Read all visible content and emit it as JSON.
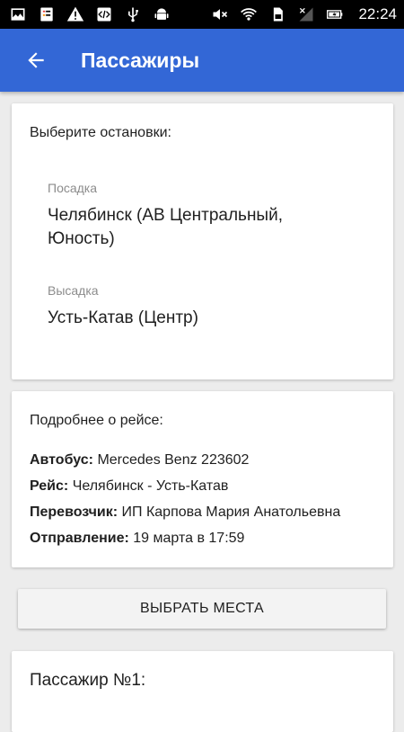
{
  "status_bar": {
    "time": "22:24",
    "left_icons": [
      "gallery-icon",
      "task-icon",
      "warning-icon",
      "code-icon",
      "usb-icon",
      "android-icon"
    ],
    "right_icons": [
      "mute-icon",
      "wifi-icon",
      "sim-icon",
      "signal-icon",
      "battery-icon"
    ]
  },
  "app_bar": {
    "title": "Пассажиры",
    "color": "#3367d6"
  },
  "stops": {
    "heading": "Выберите остановки:",
    "boarding_label": "Посадка",
    "boarding_value": "Челябинск (АВ Центральный, Юность)",
    "dropoff_label": "Высадка",
    "dropoff_value": "Усть-Катав (Центр)"
  },
  "trip": {
    "heading": "Подробнее о рейсе:",
    "rows": [
      {
        "label": "Автобус:",
        "value": "Mercedes Benz 223602"
      },
      {
        "label": "Рейс:",
        "value": "Челябинск - Усть-Катав"
      },
      {
        "label": "Перевозчик:",
        "value": "ИП Карпова Мария Анатольевна"
      },
      {
        "label": "Отправление:",
        "value": "19 марта в 17:59"
      }
    ]
  },
  "select_seats_button": "ВЫБРАТЬ МЕСТА",
  "passenger": {
    "heading": "Пассажир №1:"
  }
}
